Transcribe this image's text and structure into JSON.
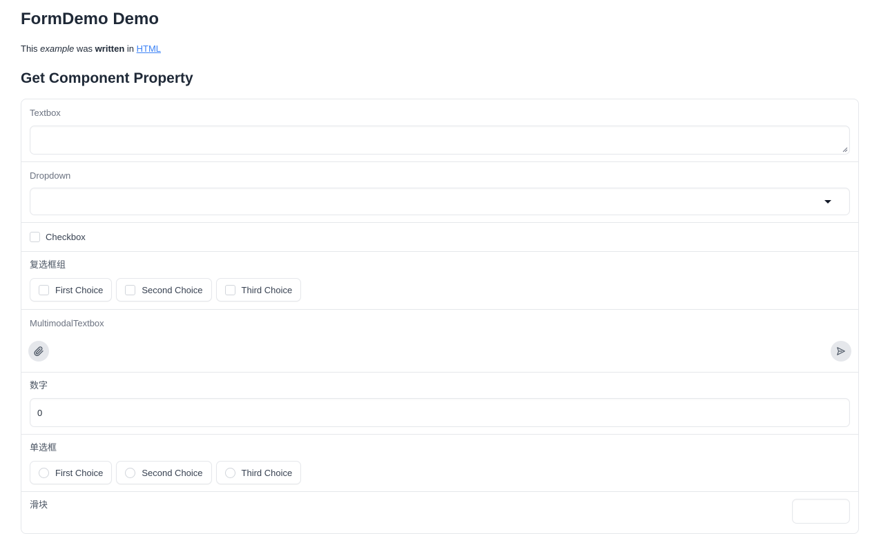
{
  "header": {
    "title": "FormDemo Demo",
    "intro": {
      "p1": "This ",
      "em": "example",
      "p2": " was ",
      "strong": "written",
      "p3": " in ",
      "link": "HTML"
    }
  },
  "section_title": "Get Component Property",
  "fields": {
    "textbox": {
      "label": "Textbox",
      "value": ""
    },
    "dropdown": {
      "label": "Dropdown",
      "value": ""
    },
    "checkbox": {
      "label": "Checkbox",
      "checked": false
    },
    "checkbox_group": {
      "label": "复选框组",
      "options": [
        "First Choice",
        "Second Choice",
        "Third Choice"
      ]
    },
    "multimodal": {
      "label": "MultimodalTextbox",
      "value": ""
    },
    "number": {
      "label": "数字",
      "value": "0"
    },
    "radio": {
      "label": "单选框",
      "options": [
        "First Choice",
        "Second Choice",
        "Third Choice"
      ]
    },
    "slider": {
      "label": "滑块"
    }
  },
  "icons": {
    "dropdown": "caret-down-icon",
    "attach": "paperclip-icon",
    "send": "send-icon"
  }
}
